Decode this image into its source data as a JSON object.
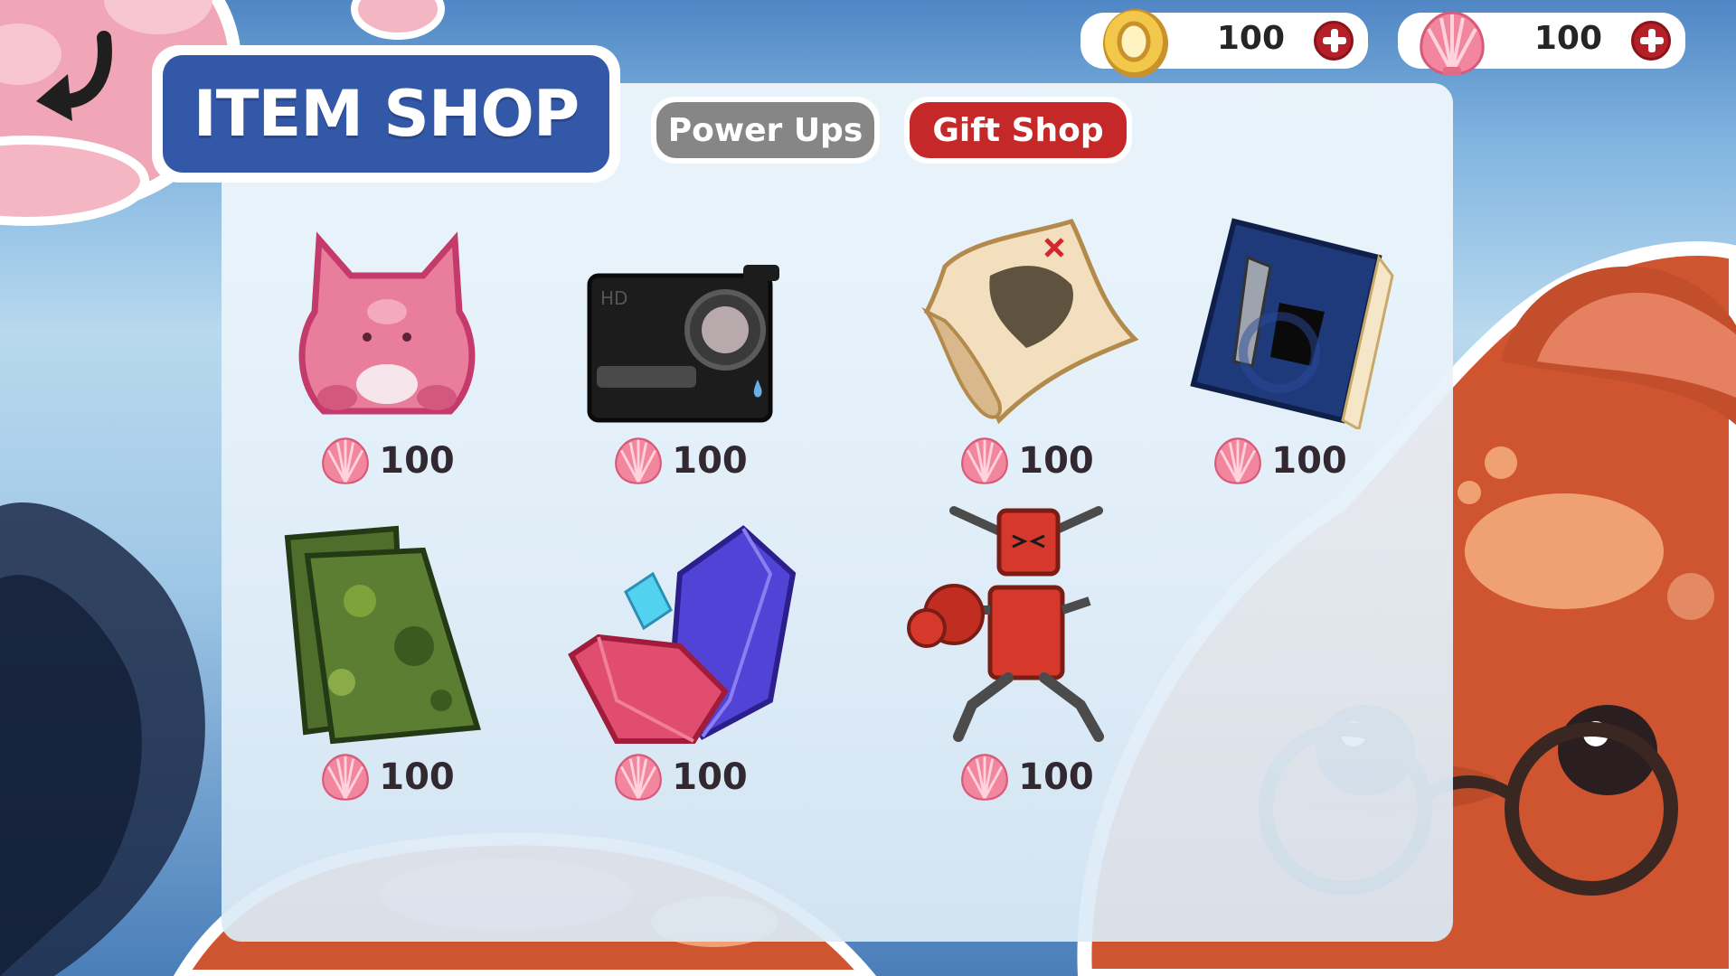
{
  "title": "ITEM SHOP",
  "tabs": [
    {
      "label": "Power Ups",
      "active": false
    },
    {
      "label": "Gift Shop",
      "active": true
    }
  ],
  "currencies": [
    {
      "icon": "gold-coin-icon",
      "amount": "100"
    },
    {
      "icon": "seashell-icon",
      "amount": "100"
    }
  ],
  "items": [
    {
      "icon": "pink-cat-plush-icon",
      "price": "100"
    },
    {
      "icon": "hd-camera-icon",
      "price": "100"
    },
    {
      "icon": "treasure-map-icon",
      "price": "100"
    },
    {
      "icon": "blue-book-icon",
      "price": "100"
    },
    {
      "icon": "seaweed-sheets-icon",
      "price": "100"
    },
    {
      "icon": "crystals-icon",
      "price": "100"
    },
    {
      "icon": "boxing-robot-icon",
      "price": "100"
    }
  ],
  "colors": {
    "title_bg": "#3458a8",
    "active_tab": "#c42828",
    "inactive_tab": "#868686",
    "octopus": "#cf5430"
  }
}
